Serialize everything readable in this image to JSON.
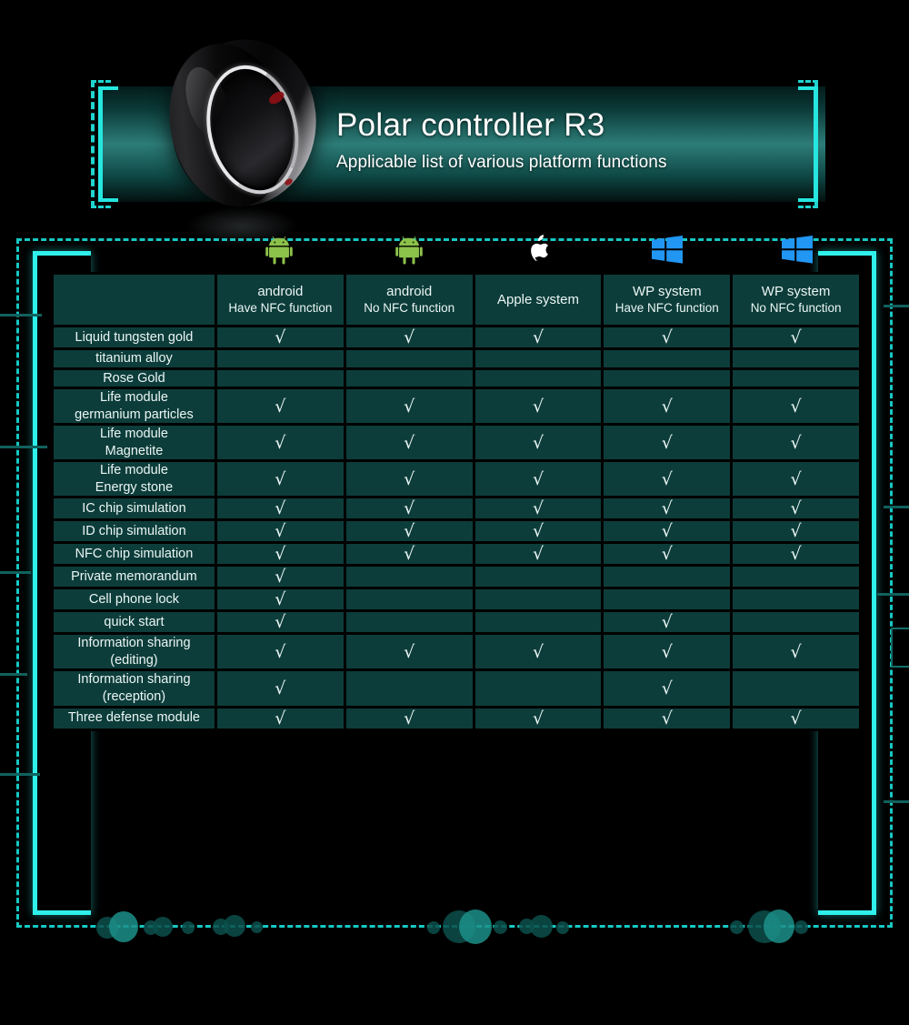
{
  "banner": {
    "title": "Polar controller R3",
    "subtitle": "Applicable list of various platform functions",
    "product_image": "smart-ring-photo",
    "accent_color": "#2ff0ea",
    "panel_color": "#2d7d78"
  },
  "table": {
    "corner_label": "",
    "check_symbol": "√",
    "columns": [
      {
        "icon": "android-robot-icon",
        "icon_color": "#8cc24a",
        "line1": "android",
        "line2": "Have NFC function"
      },
      {
        "icon": "android-robot-icon",
        "icon_color": "#8cc24a",
        "line1": "android",
        "line2": "No NFC function"
      },
      {
        "icon": "apple-logo-icon",
        "icon_color": "#ffffff",
        "line1": "Apple system",
        "line2": ""
      },
      {
        "icon": "windows-logo-icon",
        "icon_color": "#2196f3",
        "line1": "WP system",
        "line2": "Have NFC function"
      },
      {
        "icon": "windows-logo-icon",
        "icon_color": "#2196f3",
        "line1": "WP system",
        "line2": "No NFC function"
      }
    ],
    "rows": [
      {
        "label": "Liquid tungsten gold",
        "label_lines": [
          "Liquid tungsten gold"
        ],
        "values": [
          true,
          true,
          true,
          true,
          true
        ]
      },
      {
        "label": "titanium alloy",
        "label_lines": [
          "titanium alloy"
        ],
        "values": [
          false,
          false,
          false,
          false,
          false
        ]
      },
      {
        "label": "Rose Gold",
        "label_lines": [
          "Rose Gold"
        ],
        "values": [
          false,
          false,
          false,
          false,
          false
        ]
      },
      {
        "label": "Life module germanium particles",
        "label_lines": [
          "Life module",
          "germanium particles"
        ],
        "values": [
          true,
          true,
          true,
          true,
          true
        ]
      },
      {
        "label": "Life module Magnetite",
        "label_lines": [
          "Life module",
          "Magnetite"
        ],
        "values": [
          true,
          true,
          true,
          true,
          true
        ]
      },
      {
        "label": "Life module Energy stone",
        "label_lines": [
          "Life module",
          "Energy stone"
        ],
        "values": [
          true,
          true,
          true,
          true,
          true
        ]
      },
      {
        "label": "IC chip simulation",
        "label_lines": [
          "IC chip simulation"
        ],
        "values": [
          true,
          true,
          true,
          true,
          true
        ]
      },
      {
        "label": "ID chip simulation",
        "label_lines": [
          "ID chip simulation"
        ],
        "values": [
          true,
          true,
          true,
          true,
          true
        ]
      },
      {
        "label": "NFC chip simulation",
        "label_lines": [
          "NFC chip simulation"
        ],
        "values": [
          true,
          true,
          true,
          true,
          true
        ]
      },
      {
        "label": "Private memorandum",
        "label_lines": [
          "Private memorandum"
        ],
        "values": [
          true,
          false,
          false,
          false,
          false
        ]
      },
      {
        "label": "Cell phone lock",
        "label_lines": [
          "Cell phone lock"
        ],
        "values": [
          true,
          false,
          false,
          false,
          false
        ]
      },
      {
        "label": "quick start",
        "label_lines": [
          "quick start"
        ],
        "values": [
          true,
          false,
          false,
          true,
          false
        ]
      },
      {
        "label": "Information sharing (editing)",
        "label_lines": [
          "Information sharing",
          "(editing)"
        ],
        "values": [
          true,
          true,
          true,
          true,
          true
        ]
      },
      {
        "label": "Information sharing (reception)",
        "label_lines": [
          "Information sharing",
          "(reception)"
        ],
        "values": [
          true,
          false,
          false,
          true,
          false
        ]
      },
      {
        "label": "Three defense module",
        "label_lines": [
          "Three defense module"
        ],
        "values": [
          true,
          true,
          true,
          true,
          true
        ]
      }
    ]
  }
}
